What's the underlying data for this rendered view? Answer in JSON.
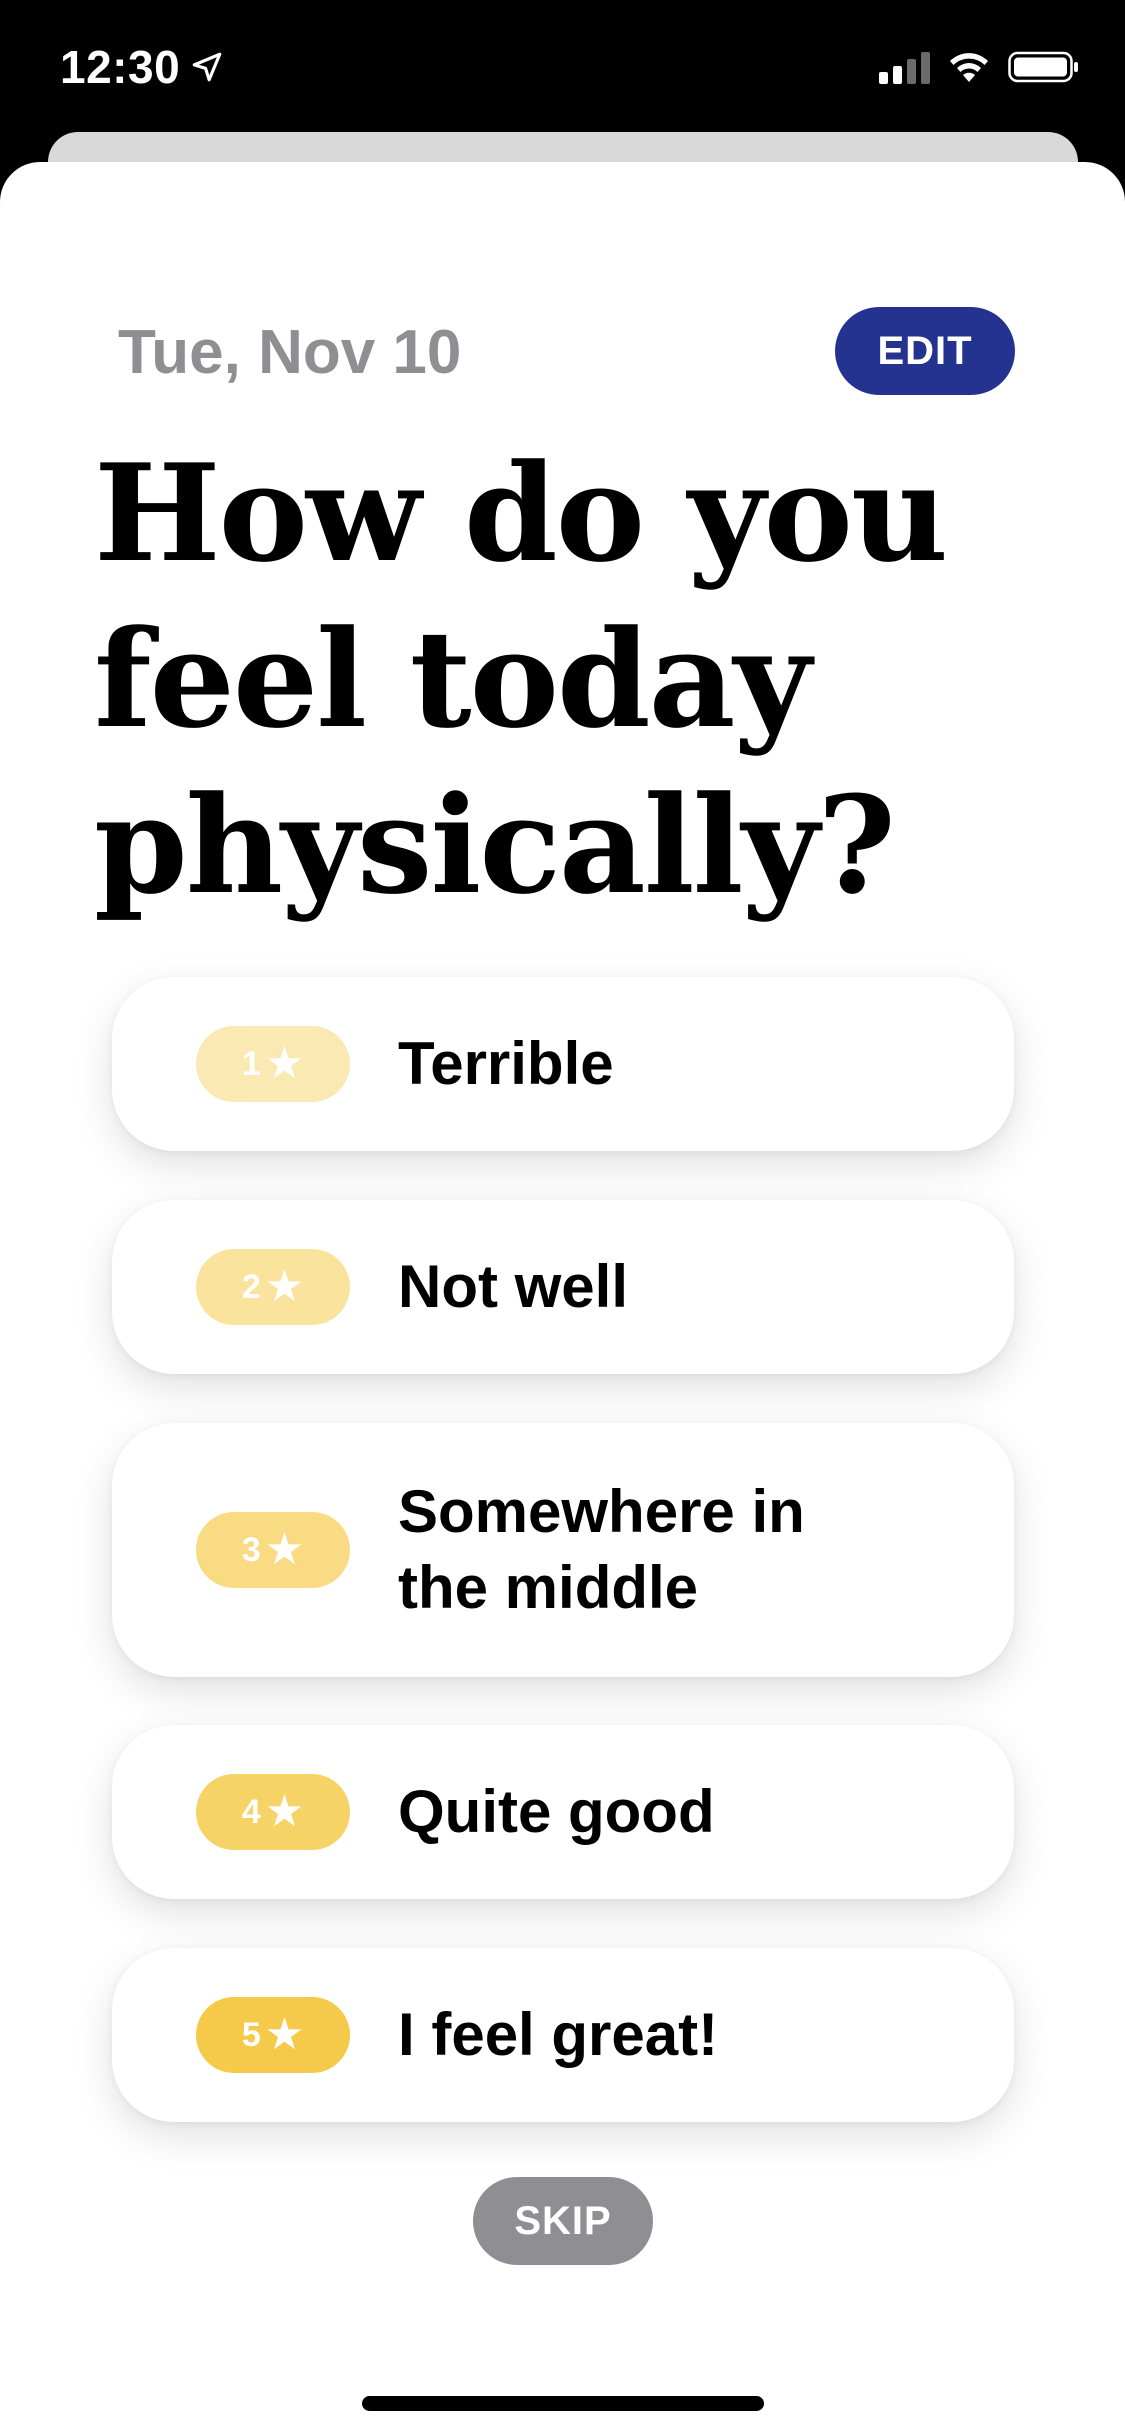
{
  "status_bar": {
    "time": "12:30",
    "location_icon": "location-arrow-icon",
    "signal_icon": "cellular-signal-icon",
    "wifi_icon": "wifi-icon",
    "battery_icon": "battery-icon"
  },
  "header": {
    "date": "Tue, Nov 10",
    "edit_label": "EDIT"
  },
  "question": {
    "line1": "How do you",
    "line2": "feel today",
    "line3": "physically?"
  },
  "options": [
    {
      "rating": "1",
      "label": "Terrible",
      "badge_color": "#fbe9b3"
    },
    {
      "rating": "2",
      "label": "Not well",
      "badge_color": "#fae39c"
    },
    {
      "rating": "3",
      "label": "Somewhere in the middle",
      "badge_color": "#f8db82"
    },
    {
      "rating": "4",
      "label": "Quite good",
      "badge_color": "#f6d366"
    },
    {
      "rating": "5",
      "label": "I feel great!",
      "badge_color": "#f5c94a"
    }
  ],
  "star_glyph": "★",
  "skip_label": "SKIP",
  "colors": {
    "accent": "#24338f",
    "muted": "#8e8e93"
  }
}
